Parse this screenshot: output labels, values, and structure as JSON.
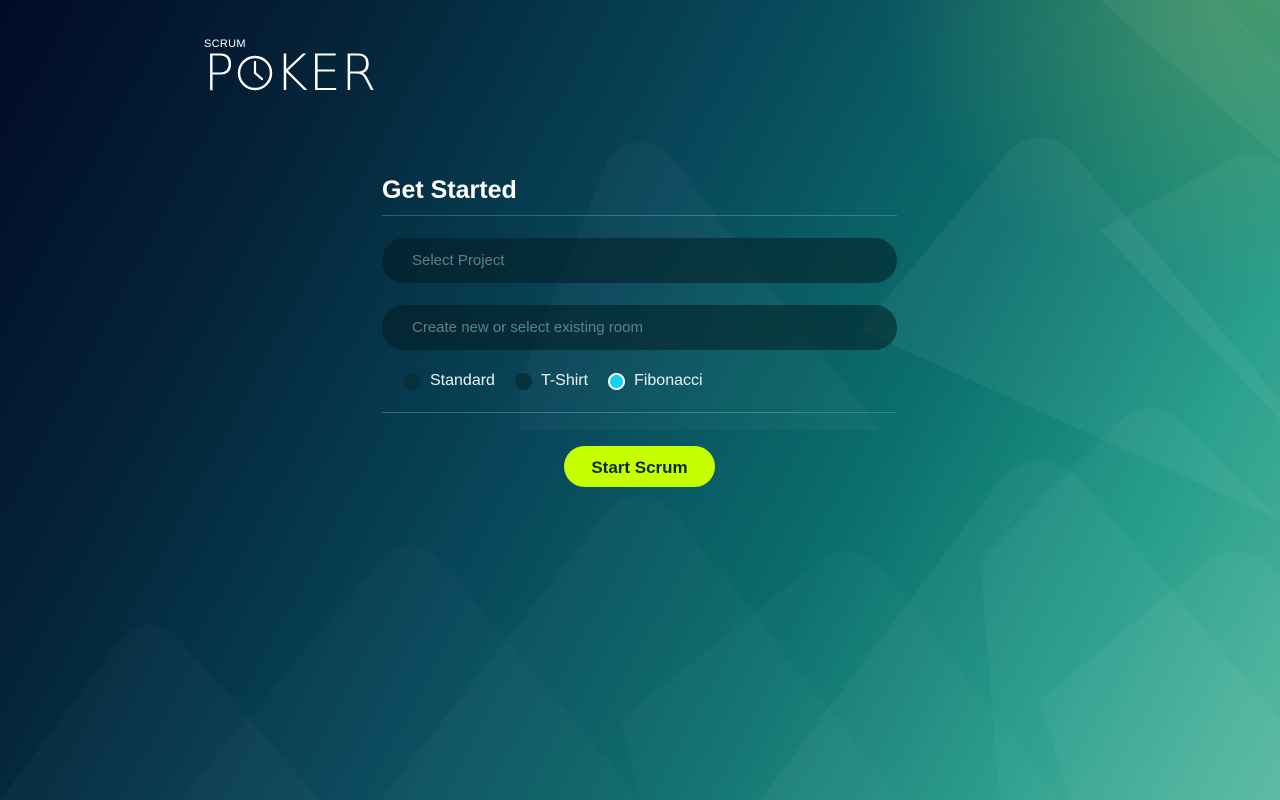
{
  "app": {
    "logo": {
      "small_text": "SCRUM",
      "big_text_prefix": "P",
      "big_text_suffix": "KER",
      "clock_icon": "clock-icon"
    }
  },
  "form": {
    "title": "Get Started",
    "project_field": {
      "placeholder": "Select Project",
      "value": ""
    },
    "room_field": {
      "placeholder": "Create new or select existing room",
      "value": ""
    },
    "estimation_options": [
      {
        "label": "Standard",
        "selected": false
      },
      {
        "label": "T-Shirt",
        "selected": false
      },
      {
        "label": "Fibonacci",
        "selected": true
      }
    ],
    "submit_label": "Start Scrum"
  },
  "colors": {
    "accent": "#c6ff00",
    "radio_selected": "#0fd3f5",
    "background_dark": "#020a26",
    "background_light": "#4cb49b"
  }
}
